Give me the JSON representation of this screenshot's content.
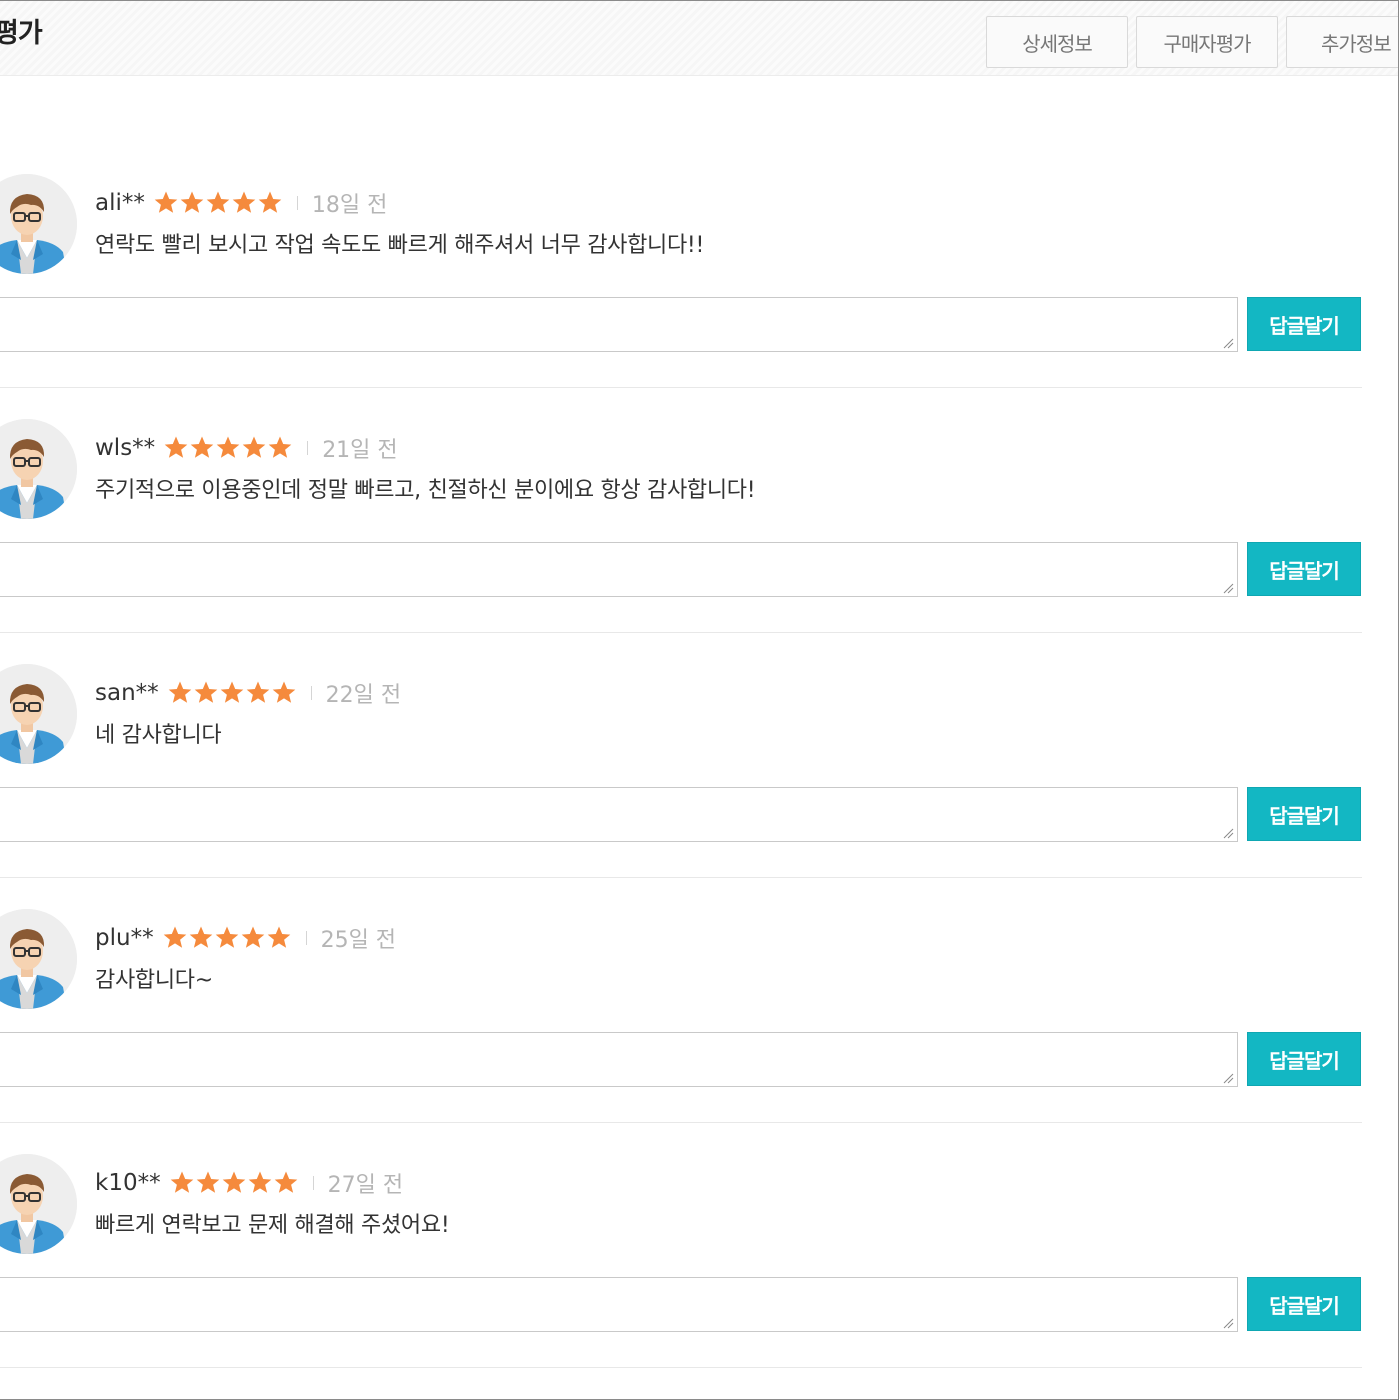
{
  "header": {
    "section_title": "평가",
    "tabs": [
      {
        "label": "상세정보"
      },
      {
        "label": "구매자평가"
      },
      {
        "label": "추가정보"
      }
    ]
  },
  "colors": {
    "accent": "#13b7c3",
    "star": "#f58a3c",
    "date": "#b5b5b5"
  },
  "reviews": [
    {
      "user": "ali**",
      "rating": 5,
      "date": "18일 전",
      "comment": "연락도 빨리 보시고 작업 속도도 빠르게 해주셔서 너무 감사합니다!!",
      "reply_label": "답글달기"
    },
    {
      "user": "wls**",
      "rating": 5,
      "date": "21일 전",
      "comment": "주기적으로 이용중인데 정말 빠르고, 친절하신 분이에요 항상 감사합니다!",
      "reply_label": "답글달기"
    },
    {
      "user": "san**",
      "rating": 5,
      "date": "22일 전",
      "comment": "네 감사합니다",
      "reply_label": "답글달기"
    },
    {
      "user": "plu**",
      "rating": 5,
      "date": "25일 전",
      "comment": "감사합니다~",
      "reply_label": "답글달기"
    },
    {
      "user": "k10**",
      "rating": 5,
      "date": "27일 전",
      "comment": "빠르게 연락보고 문제 해결해 주셨어요!",
      "reply_label": "답글달기"
    }
  ]
}
